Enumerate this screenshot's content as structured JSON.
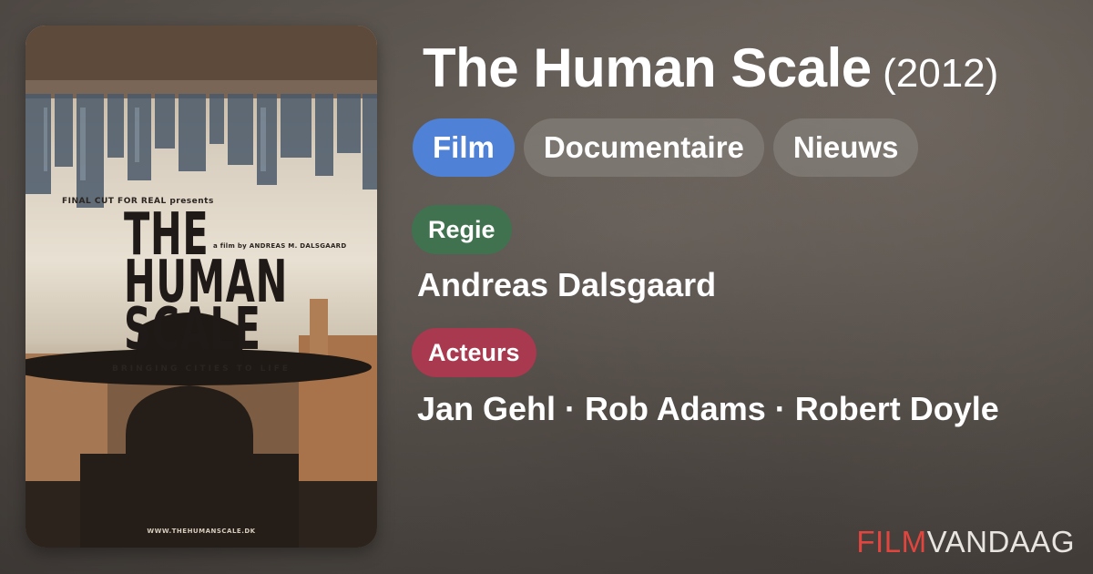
{
  "title": "The Human Scale",
  "year": "(2012)",
  "genres": [
    {
      "label": "Film",
      "active": true
    },
    {
      "label": "Documentaire",
      "active": false
    },
    {
      "label": "Nieuws",
      "active": false
    }
  ],
  "director_label": "Regie",
  "director": "Andreas Dalsgaard",
  "actors_label": "Acteurs",
  "actors": "Jan Gehl · Rob Adams · Robert Doyle",
  "brand": {
    "part1": "FILM",
    "part2": "VANDAAG"
  },
  "poster": {
    "presents": "FINAL CUT FOR REAL presents",
    "director_credit": "a film by ANDREAS M. DALSGAARD",
    "title_lines": [
      "THE",
      "HUMAN",
      "SCALE"
    ],
    "tagline": "BRINGING CITIES TO LIFE",
    "url": "WWW.THEHUMANSCALE.DK"
  },
  "colors": {
    "active_chip": "#4f82d6",
    "regie_pill": "#41724f",
    "acteurs_pill": "#a8394e",
    "brand_accent": "#e2453e"
  }
}
